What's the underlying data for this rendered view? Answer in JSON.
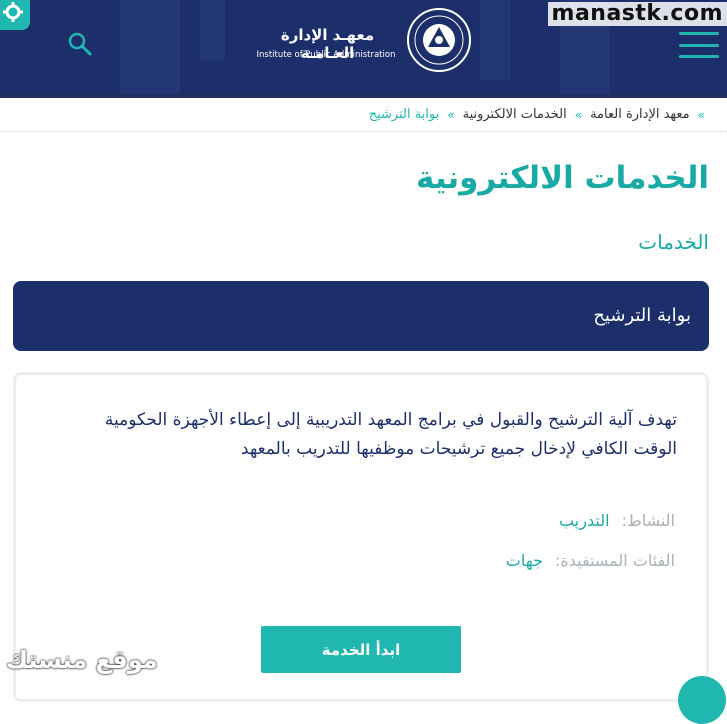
{
  "header": {
    "logo_ar": "معهـد الإدارة العـامـة",
    "logo_en": "Institute of Public Administration",
    "watermark": "manastk.com"
  },
  "breadcrumb": [
    {
      "label": "معهد الإدارة العامة"
    },
    {
      "label": "الخدمات الالكترونية"
    },
    {
      "label": "بوابة الترشيح"
    }
  ],
  "page": {
    "title": "الخدمات الالكترونية",
    "subtitle": "الخدمات"
  },
  "card": {
    "header": "بوابة الترشيح",
    "description": "تهدف آلية الترشيح والقبول في برامج المعهد التدريبية إلى إعطاء الأجهزة الحكومية الوقت الكافي لإدخال جميع ترشيحات موظفيها للتدريب بالمعهد",
    "activity_label": "النشاط:",
    "activity_value": "التدريب",
    "beneficiaries_label": "الفئات المستفيدة:",
    "beneficiaries_value": "جهات",
    "start_button": "ابدأ الخدمة"
  },
  "bottom_watermark": "موقع منستك",
  "colors": {
    "primary": "#1d2f6b",
    "accent": "#20b7b0"
  },
  "icons": {
    "search": "search-icon",
    "menu": "menu-icon",
    "settings": "gear-icon"
  }
}
